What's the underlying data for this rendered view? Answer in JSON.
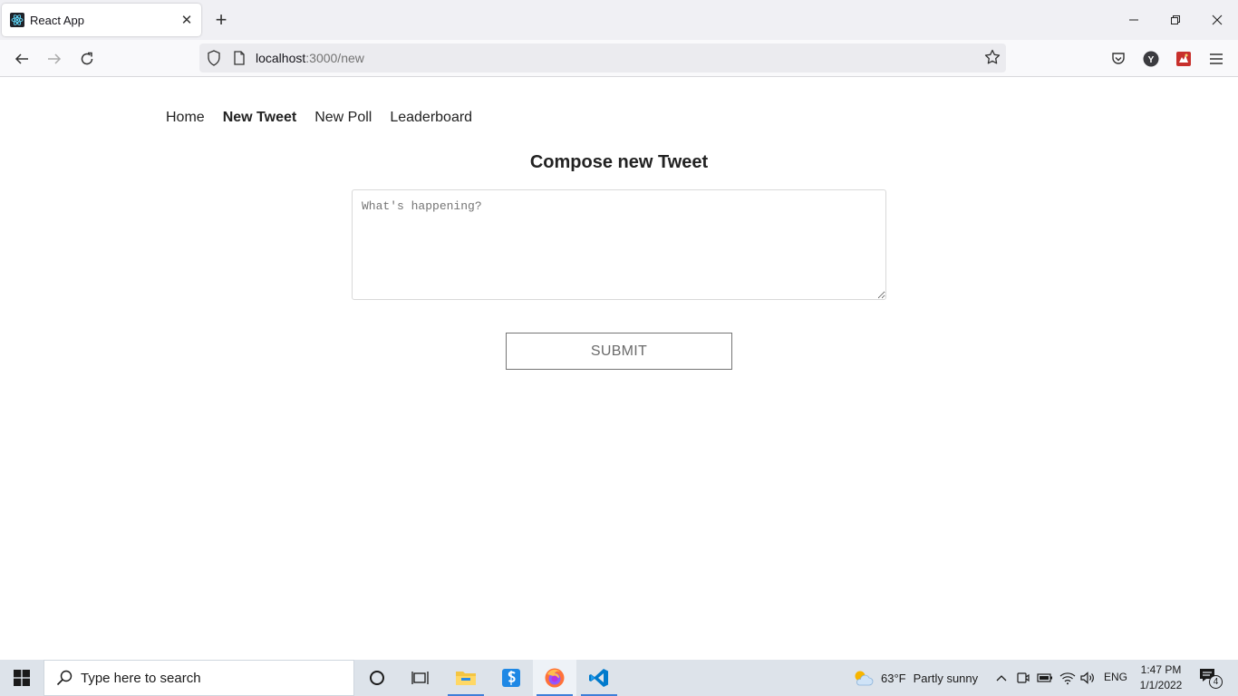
{
  "browser": {
    "tab_title": "React App",
    "url_host": "localhost",
    "url_path": ":3000/new",
    "profile_initial": "Y"
  },
  "app_nav": {
    "items": [
      {
        "label": "Home",
        "active": false
      },
      {
        "label": "New Tweet",
        "active": true
      },
      {
        "label": "New Poll",
        "active": false
      },
      {
        "label": "Leaderboard",
        "active": false
      }
    ]
  },
  "compose": {
    "title": "Compose new Tweet",
    "placeholder": "What's happening?",
    "value": "",
    "submit_label": "SUBMIT"
  },
  "taskbar": {
    "search_placeholder": "Type here to search",
    "weather_temp": "63°F",
    "weather_text": "Partly sunny",
    "language": "ENG",
    "time": "1:47 PM",
    "date": "1/1/2022",
    "notification_count": "4"
  },
  "colors": {
    "accent": "#3f7fd8",
    "vscode_blue": "#007acc",
    "firefox_orange": "#ff7139"
  }
}
